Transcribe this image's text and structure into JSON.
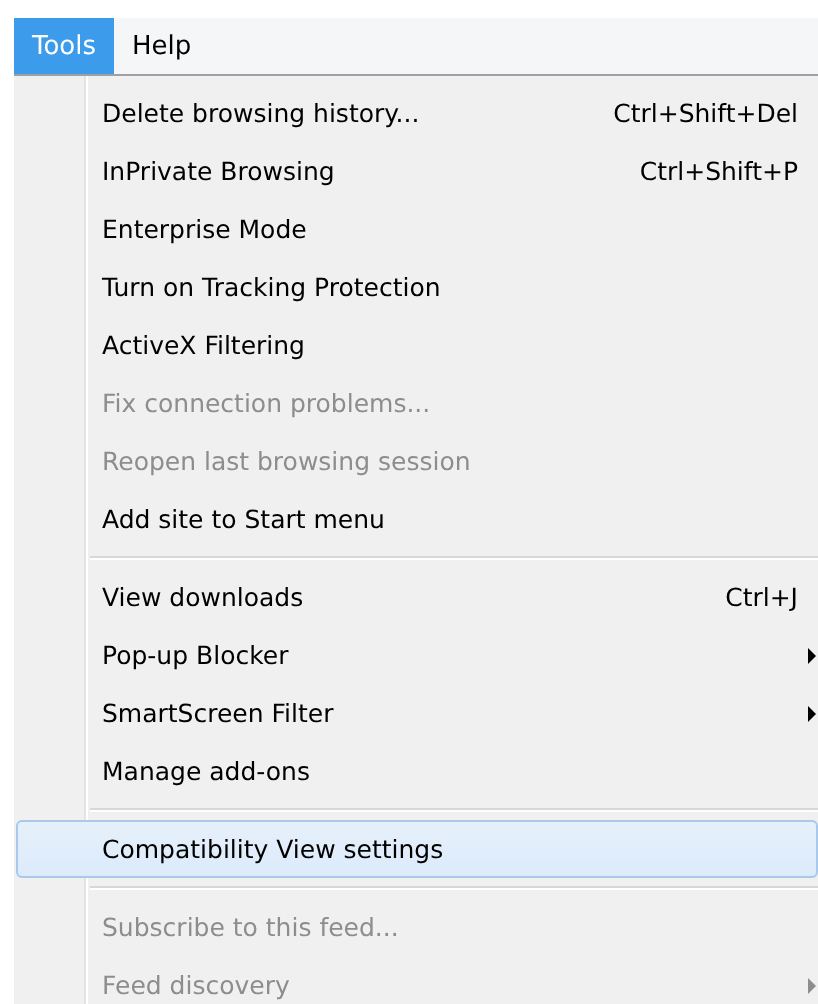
{
  "menubar": [
    {
      "label": "Tools",
      "selected": true
    },
    {
      "label": "Help",
      "selected": false
    }
  ],
  "menu": {
    "sections": [
      {
        "items": [
          {
            "label": "Delete browsing history...",
            "shortcut": "Ctrl+Shift+Del",
            "disabled": false,
            "submenu": false,
            "selected": false
          },
          {
            "label": "InPrivate Browsing",
            "shortcut": "Ctrl+Shift+P",
            "disabled": false,
            "submenu": false,
            "selected": false
          },
          {
            "label": "Enterprise Mode",
            "disabled": false,
            "submenu": false,
            "selected": false
          },
          {
            "label": "Turn on Tracking Protection",
            "disabled": false,
            "submenu": false,
            "selected": false
          },
          {
            "label": "ActiveX Filtering",
            "disabled": false,
            "submenu": false,
            "selected": false
          },
          {
            "label": "Fix connection problems...",
            "disabled": true,
            "submenu": false,
            "selected": false
          },
          {
            "label": "Reopen last browsing session",
            "disabled": true,
            "submenu": false,
            "selected": false
          },
          {
            "label": "Add site to Start menu",
            "disabled": false,
            "submenu": false,
            "selected": false
          }
        ]
      },
      {
        "items": [
          {
            "label": "View downloads",
            "shortcut": "Ctrl+J",
            "disabled": false,
            "submenu": false,
            "selected": false
          },
          {
            "label": "Pop-up Blocker",
            "disabled": false,
            "submenu": true,
            "selected": false
          },
          {
            "label": "SmartScreen Filter",
            "disabled": false,
            "submenu": true,
            "selected": false
          },
          {
            "label": "Manage add-ons",
            "disabled": false,
            "submenu": false,
            "selected": false
          }
        ]
      },
      {
        "items": [
          {
            "label": "Compatibility View settings",
            "disabled": false,
            "submenu": false,
            "selected": true
          }
        ]
      },
      {
        "items": [
          {
            "label": "Subscribe to this feed...",
            "disabled": true,
            "submenu": false,
            "selected": false
          },
          {
            "label": "Feed discovery",
            "disabled": true,
            "submenu": true,
            "selected": false
          }
        ]
      }
    ]
  }
}
